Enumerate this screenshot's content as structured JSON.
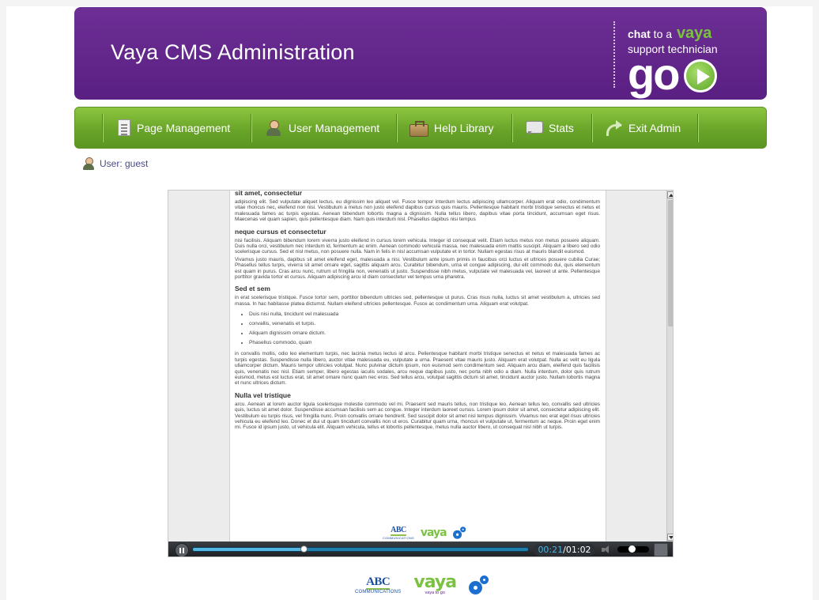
{
  "header": {
    "title": "Vaya CMS Administration",
    "chat_prefix": "chat",
    "chat_to": " to a",
    "chat_brand": "vaya",
    "chat_line2": "support technician",
    "go_label": "go"
  },
  "nav": {
    "items": [
      {
        "label": "Page Management",
        "icon": "page-icon"
      },
      {
        "label": "User Management",
        "icon": "user-icon"
      },
      {
        "label": "Help Library",
        "icon": "briefcase-icon"
      },
      {
        "label": "Stats",
        "icon": "speech-bubble-icon"
      },
      {
        "label": "Exit Admin",
        "icon": "exit-arrow-icon"
      }
    ]
  },
  "user_status": {
    "label": "User: guest"
  },
  "video": {
    "current_time": "00:21",
    "separator": "/",
    "total_time": "01:02",
    "progress": 0.33,
    "volume": 0.45,
    "document": {
      "sections": [
        {
          "heading": "sit amet, consectetur",
          "paragraphs": [
            "adipiscing elit. Sed vulputate aliquet lectus, eu dignissim leo aliquet vel. Fusce tempor interdum lectus adipiscing ullamcorper. Aliquam erat odio, condimentum vitae rhoncus nec, eleifend non nisi. Vestibulum a metus non justo eleifend dapibus cursus quis mauris. Pellentesque habitant morbi tristique senectus et netus et malesuada fames ac turpis egestas. Aenean bibendum lobortis magna a dignissim. Nulla tellus libero, dapibus vitae porta tincidunt, accumsan eget risus. Maecenas vel quam sapien, quis pellentesque diam. Nam quis interdum nisl. Phasellus dapibus nisi tempus"
          ]
        },
        {
          "heading": "neque cursus et consectetur",
          "paragraphs": [
            "nisi facilisis. Aliquam bibendum lorem viverra justo eleifend in cursus lorem vehicula. Integer id consequat velit. Etiam luctus metus non metus posuere aliquam. Duis nulla orci, vestibulum nec interdum id, fermentum ac enim. Aenean commodo vehicula massa, nec malesuada enim mattis suscipit. Aliquam a libero sed odio scelerisque cursus. Sed et nisl metus, non posuere nulla. Nam in felis in nisl accumsan vulputate et in tortor. Nullam egestas risus at mauris blandit euismod.",
            "Vivamus justo mauris, dapibus sit amet eleifend eget, malesuada a nisi. Vestibulum ante ipsum primis in faucibus orci luctus et ultrices posuere cubilia Curae; Phasellus tellus turpis, viverra sit amet ornare eget, sagittis aliquam arcu. Curabitur bibendum, urna et congue adipiscing, dui elit commodo dui, quis elementum est quam in purus. Cras arcu nunc, rutrum ut fringilla non, venenatis ut justo. Suspendisse nibh metus, vulputate vel malesuada vel, laoreet ut ante. Pellentesque porttitor gravida tortor et cursus. Aliquam adipiscing arcu id diam consectetur vel tempus urna pharetra."
          ]
        },
        {
          "heading": "Sed et sem",
          "paragraphs": [
            "in erat scelerisque tristique. Fusce tortor sem, porttitor bibendum ultricies sed, pellentesque ut purus. Cras risus nulla, luctus sit amet vestibulum a, ultricies sed massa. In hac habitasse platea dictumst. Nullam eleifend ultricies pellentesque. Fusce ac condimentum urna. Aliquam erat volutpat."
          ],
          "bullets": [
            "Duis nisi nulla, tincidunt vel malesuada",
            "convallis, venenatis et turpis.",
            "Aliquam dignissim ornare dictum.",
            "Phasellus commodo, quam"
          ],
          "after": "in convallis mollis, odio leo elementum turpis, nec lacinia metus lectus id arcu. Pellentesque habitant morbi tristique senectus et netus et malesuada fames ac turpis egestas. Suspendisse nulla libero, auctor vitae malesuada eu, vulputate a urna. Praesent vitae mauris justo. Aliquam erat volutpat. Nulla ac velit eu ligula ullamcorper dictum. Mauris tempor ultricies volutpat. Nunc pulvinar dictum ipsum, non euismod sem condimentum sed. Aliquam arcu diam, eleifend quis facilisis quis, venenatis nec nisl. Etiam semper, libero egestas iaculis sodales, arcu neque dapibus justo, nec porta nibh odio a diam. Nulla interdum, dolor quis rutrum euismod, metus est luctus erat, sit amet ornare nunc quam nec eros. Sed tellus arcu, volutpat sagittis dictum sit amet, tincidunt auctor justo. Nullam lobortis magna et nunc ultrices dictum."
        },
        {
          "heading": "Nulla vel tristique",
          "paragraphs": [
            "arcu. Aenean at lorem auctor ligula scelerisque molestie commodo vel mi. Praesent sed mauris tellus, non tristique leo. Aenean tellus leo, convallis sed ultricies quis, luctus sit amet dolor. Suspendisse accumsan facilisis sem ac congue. Integer interdum laoreet cursus. Lorem ipsum dolor sit amet, consectetur adipiscing elit. Vestibulum eu turpis risus, vel fringilla nunc. Proin convallis ornare hendrerit. Sed suscipit dolor sit amet nisl tempus dignissim. Vivamus nec erat eget risus ultricies vehicula eu eleifend leo. Donec et dui ut quam tincidunt convallis non ut eros. Curabitur quam urna, rhoncus et vulputate ut, fermentum ac neque. Proin eget enim mi. Fusce id ipsum justo, ut vehicula elit. Aliquam vehicula, tellus et lobortis pellentesque, metus nulla auctor libero, ut consequat nisl nibh ut turpis."
          ]
        }
      ]
    }
  },
  "logos": {
    "abc": "ABC",
    "abc_sub": "COMMUNICATIONS",
    "vaya": "vaya",
    "vaya_sub": "vaya to go"
  },
  "colors": {
    "header_purple": "#5a1f82",
    "nav_green": "#6aa52a",
    "brand_green": "#7cc242",
    "progress_blue": "#4db3e6"
  }
}
